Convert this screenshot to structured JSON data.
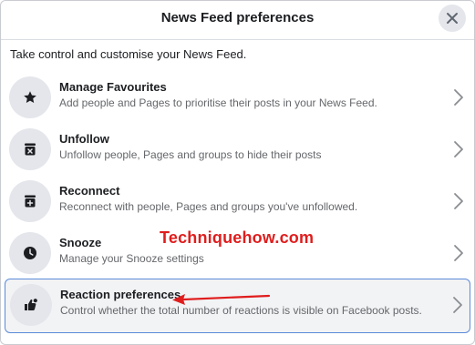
{
  "dialog": {
    "title": "News Feed preferences",
    "intro": "Take control and customise your News Feed."
  },
  "items": [
    {
      "title": "Manage Favourites",
      "description": "Add people and Pages to prioritise their posts in your News Feed.",
      "icon": "star-icon"
    },
    {
      "title": "Unfollow",
      "description": "Unfollow people, Pages and groups to hide their posts",
      "icon": "unfollow-box-icon"
    },
    {
      "title": "Reconnect",
      "description": "Reconnect with people, Pages and groups you've unfollowed.",
      "icon": "reconnect-box-icon"
    },
    {
      "title": "Snooze",
      "description": "Manage your Snooze settings",
      "icon": "clock-icon"
    },
    {
      "title": "Reaction preferences",
      "description": "Control whether the total number of reactions is visible on Facebook posts.",
      "icon": "thumbs-up-icon"
    }
  ],
  "watermark": "Techniquehow.com",
  "colors": {
    "accent_border": "#5b8bd9",
    "arrow": "#e01d1d",
    "watermark": "#e01d1d",
    "icon_bg": "#e4e6eb"
  }
}
